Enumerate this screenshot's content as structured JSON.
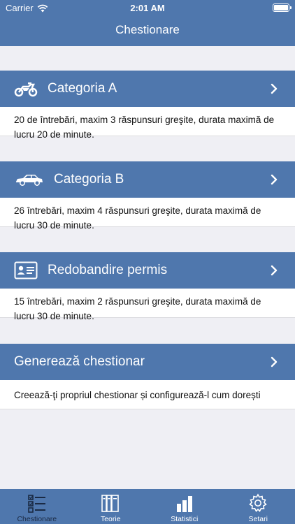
{
  "status_bar": {
    "carrier": "Carrier",
    "time": "2:01 AM"
  },
  "nav": {
    "title": "Chestionare"
  },
  "categories": [
    {
      "title": "Categoria A",
      "icon": "motorcycle-icon",
      "description": "20 de întrebări, maxim 3 răspunsuri greşite, durata maximă de lucru 20 de minute."
    },
    {
      "title": "Categoria B",
      "icon": "car-icon",
      "description": "26 întrebări, maxim 4 răspunsuri greşite, durata maximă de lucru 30 de minute."
    },
    {
      "title": "Redobandire permis",
      "icon": "id-card-icon",
      "description": "15 întrebări, maxim 2 răspunsuri greşite, durata maximă de lucru 30 de minute."
    },
    {
      "title": "Generează chestionar",
      "icon": "",
      "description": "Creează-ţi propriul chestionar și configurează-l cum dorești"
    }
  ],
  "tabs": [
    {
      "label": "Chestionare",
      "icon": "checklist-icon"
    },
    {
      "label": "Teorie",
      "icon": "books-icon"
    },
    {
      "label": "Statistici",
      "icon": "bar-chart-icon"
    },
    {
      "label": "Setari",
      "icon": "gear-icon"
    }
  ],
  "colors": {
    "accent": "#4f77ad",
    "background": "#efeff4",
    "tab_active": "#1a2a44"
  }
}
